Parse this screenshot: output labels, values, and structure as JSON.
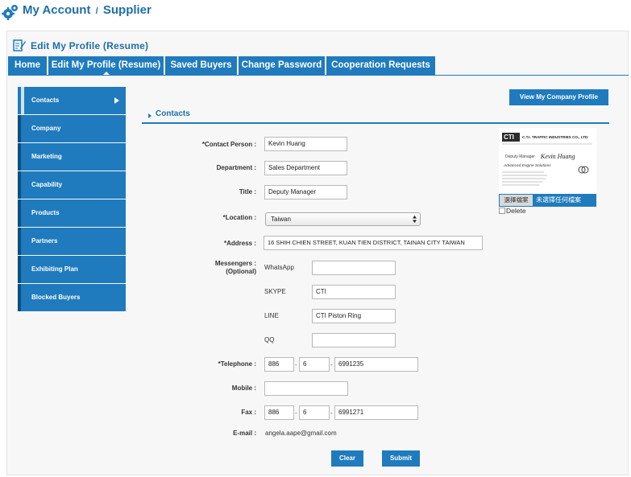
{
  "header": {
    "account": "My Account",
    "separator": "/",
    "role": "Supplier"
  },
  "page": {
    "title": "Edit My Profile (Resume)"
  },
  "tabs": [
    {
      "label": "Home",
      "active": false
    },
    {
      "label": "Edit My Profile (Resume)",
      "active": true
    },
    {
      "label": "Saved Buyers",
      "active": false
    },
    {
      "label": "Change Password",
      "active": false
    },
    {
      "label": "Cooperation Requests",
      "active": false
    }
  ],
  "sidebar": {
    "items": [
      {
        "label": "Contacts",
        "active": true
      },
      {
        "label": "Company"
      },
      {
        "label": "Marketing"
      },
      {
        "label": "Capability"
      },
      {
        "label": "Products"
      },
      {
        "label": "Partners"
      },
      {
        "label": "Exhibiting Plan"
      },
      {
        "label": "Blocked Buyers"
      }
    ]
  },
  "view_company_profile": "View My Company Profile",
  "section": {
    "title": "Contacts"
  },
  "form": {
    "contact_person": {
      "label": "Contact Person :",
      "required": "*",
      "value": "Kevin Huang"
    },
    "department": {
      "label": "Department :",
      "value": "Sales Department"
    },
    "title": {
      "label": "Title :",
      "value": "Deputy Manager"
    },
    "location": {
      "label": "Location :",
      "required": "*",
      "value": "Taiwan"
    },
    "address": {
      "label": "Address :",
      "required": "*",
      "value": "16 SHIH CHIEN STREET, KUAN TIEN DISTRICT, TAINAN CITY TAIWAN"
    },
    "messengers": {
      "label": "Messengers :",
      "optional": "(Optional)",
      "items": [
        {
          "name": "WhatsApp",
          "value": ""
        },
        {
          "name": "SKYPE",
          "value": "CTI"
        },
        {
          "name": "LINE",
          "value": "CTI Piston Ring"
        },
        {
          "name": "QQ",
          "value": ""
        }
      ]
    },
    "telephone": {
      "label": "Telephone :",
      "required": "*",
      "country": "886",
      "area": "6",
      "number": "6991235"
    },
    "mobile": {
      "label": "Mobile :",
      "value": ""
    },
    "fax": {
      "label": "Fax :",
      "country": "886",
      "area": "6",
      "number": "6991271"
    },
    "email": {
      "label": "E-mail :",
      "value": "angela.aape@gmail.com"
    },
    "dash": "-"
  },
  "business_card": {
    "logo": "CTI",
    "company": "C.T.I. TRAFFIC INDUSTRIES CO., LTD",
    "person_title": "Deputy Manager",
    "person_name": "Kevin Huang",
    "tagline": "Advanced Engine Solutions",
    "choose_file": "選擇檔案",
    "no_file": "未選擇任何檔案",
    "delete_label": "Delete"
  },
  "buttons": {
    "clear": "Clear",
    "submit": "Submit"
  },
  "colors": {
    "primary": "#1f7bbd",
    "title_text": "#1f6fa8"
  }
}
